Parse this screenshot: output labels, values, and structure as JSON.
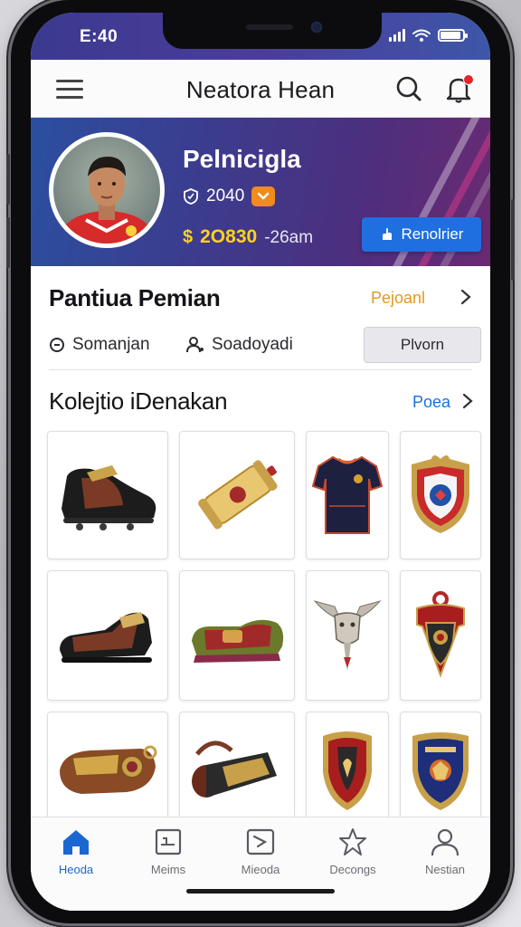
{
  "status_bar": {
    "time": "E:40"
  },
  "app_bar": {
    "title": "Neatora Hean"
  },
  "profile": {
    "name": "Pelnicigla",
    "level": "2040",
    "coins_value": "2O830",
    "coins_sub": "-26am",
    "action_label": "Renolrier",
    "rank_color": "#f08b1d",
    "coin_color": "#ffd21a",
    "button_color": "#1f6fe0"
  },
  "player_section": {
    "title": "Pantiua Pemian",
    "link": "Pejoanl",
    "meta": [
      {
        "icon": "clock-icon",
        "label": "Somanjan"
      },
      {
        "icon": "user-icon",
        "label": "Soadoyadi"
      }
    ],
    "button_label": "Plvorn"
  },
  "collection": {
    "title": "Kolejtio iDenakan",
    "link": "Poea",
    "link_color": "#1e6fd8",
    "items": [
      {
        "name": "black-football-boot"
      },
      {
        "name": "gold-trophy-scroll"
      },
      {
        "name": "navy-jersey"
      },
      {
        "name": "red-blue-crest-badge"
      },
      {
        "name": "leather-boot"
      },
      {
        "name": "vintage-slipper-shoe"
      },
      {
        "name": "winged-bull-emblem"
      },
      {
        "name": "red-shield-pendant"
      },
      {
        "name": "leather-armband"
      },
      {
        "name": "rolled-leather-scroll"
      },
      {
        "name": "red-gold-shield"
      },
      {
        "name": "blue-gold-crest"
      }
    ]
  },
  "bottom_nav": {
    "active_color": "#1a67d2",
    "items": [
      {
        "label": "Heoda",
        "icon": "home-icon",
        "active": true
      },
      {
        "label": "Meims",
        "icon": "card-icon",
        "active": false
      },
      {
        "label": "Mieoda",
        "icon": "media-icon",
        "active": false
      },
      {
        "label": "Decongs",
        "icon": "star-icon",
        "active": false
      },
      {
        "label": "Nestian",
        "icon": "profile-icon",
        "active": false
      }
    ]
  }
}
